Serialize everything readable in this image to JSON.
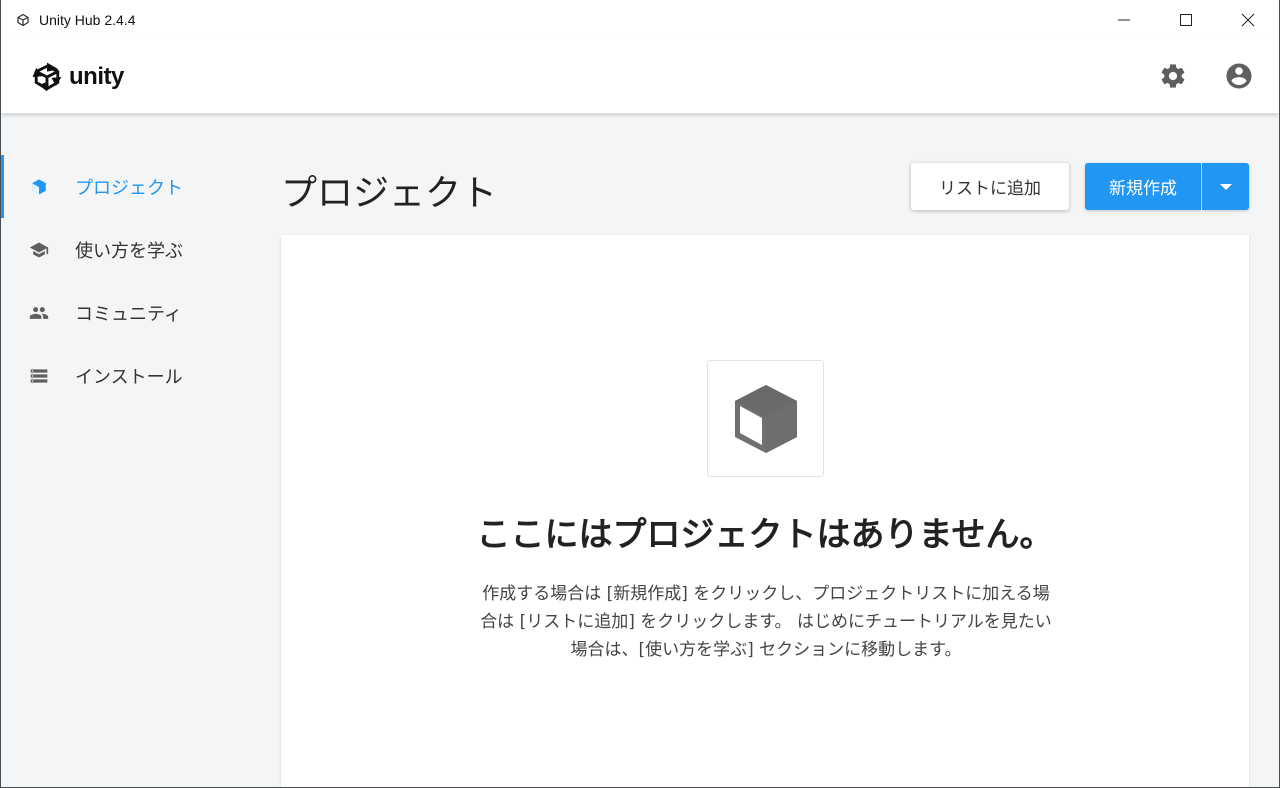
{
  "window": {
    "title": "Unity Hub 2.4.4",
    "controls": {
      "minimize_icon": "minimize-icon",
      "maximize_icon": "maximize-icon",
      "close_icon": "close-icon"
    }
  },
  "header": {
    "logo_text": "unity",
    "settings_icon": "gear-icon",
    "account_icon": "account-circle-icon"
  },
  "sidebar": {
    "items": [
      {
        "label": "プロジェクト",
        "icon": "cube-icon",
        "active": true
      },
      {
        "label": "使い方を学ぶ",
        "icon": "graduation-cap-icon",
        "active": false
      },
      {
        "label": "コミュニティ",
        "icon": "people-icon",
        "active": false
      },
      {
        "label": "インストール",
        "icon": "list-icon",
        "active": false
      }
    ]
  },
  "main": {
    "title": "プロジェクト",
    "add_button": "リストに追加",
    "new_button": "新規作成",
    "empty_state": {
      "title": "ここにはプロジェクトはありません。",
      "description": "作成する場合は [新規作成] をクリックし、プロジェクトリストに加える場合は [リストに追加] をクリックします。 はじめにチュートリアルを見たい場合は、[使い方を学ぶ] セクションに移動します。"
    }
  },
  "colors": {
    "accent": "#2196f3",
    "text": "#222222",
    "background": "#f3f5f7"
  }
}
